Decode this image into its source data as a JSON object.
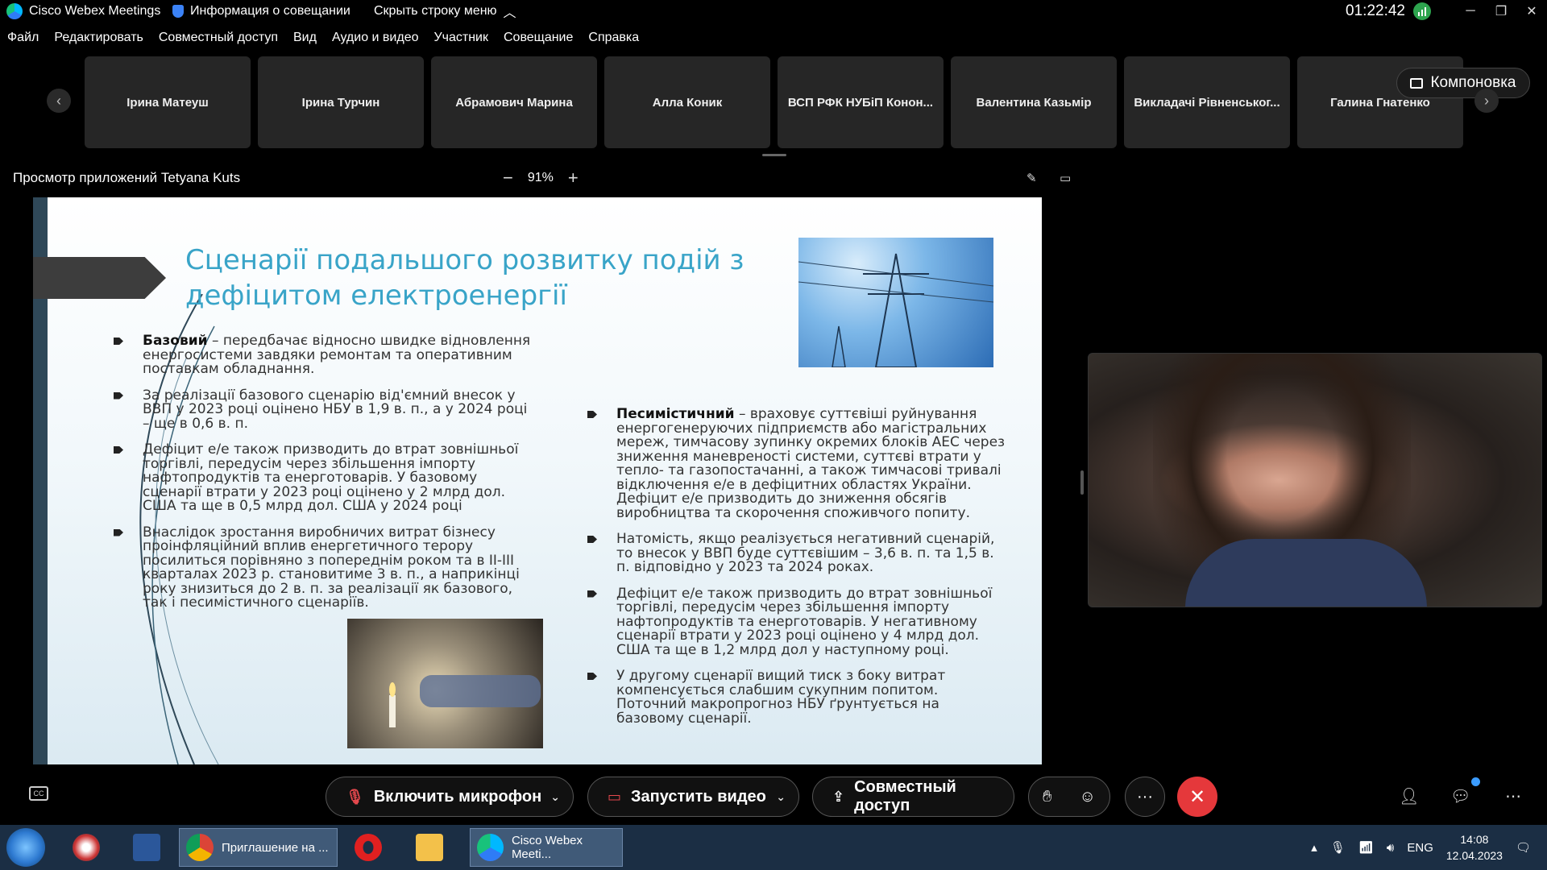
{
  "titlebar": {
    "app_name": "Cisco Webex Meetings",
    "meeting_info": "Информация о совещании",
    "hide_menu": "Скрыть строку меню",
    "time": "01:22:42"
  },
  "menu": [
    "Файл",
    "Редактировать",
    "Совместный доступ",
    "Вид",
    "Аудио и видео",
    "Участник",
    "Совещание",
    "Справка"
  ],
  "participants": [
    "Ірина Матеуш",
    "Ірина Турчин",
    "Абрамович Марина",
    "Алла Коник",
    "ВСП РФК НУБіП Конон...",
    "Валентина Казьмір",
    "Викладачі Рівненськог...",
    "Галина Гнатенко"
  ],
  "layout_button": "Компоновка",
  "share": {
    "title": "Просмотр приложений Tetyana Kuts",
    "zoom": "91%"
  },
  "slide": {
    "title": "Сценарії подальшого розвитку подій з дефіцитом електроенергії",
    "left_bullets": [
      {
        "bold": "Базовий",
        "text": " – передбачає відносно швидке відновлення енергосистеми завдяки ремонтам та оперативним поставкам обладнання."
      },
      {
        "bold": "",
        "text": "За реалізації базового сценарію від'ємний внесок у ВВП у 2023 році оцінено НБУ в 1,9 в. п., а у 2024 році – ще в 0,6 в. п."
      },
      {
        "bold": "",
        "text": "Дефіцит е/е також призводить до втрат зовнішньої торгівлі, передусім через збільшення імпорту нафтопродуктів та енерготоварів. У базовому сценарії втрати у 2023 році оцінено у 2 млрд дол. США та ще в 0,5 млрд дол. США у 2024 році"
      },
      {
        "bold": "",
        "text": "Внаслідок зростання виробничих витрат бізнесу проінфляційний вплив енергетичного терору посилиться порівняно з попереднім роком та в ІІ-ІІІ кварталах 2023 р. становитиме 3 в. п., а наприкінці року знизиться до 2 в. п. за реалізації як базового, так і песимістичного сценаріїв."
      }
    ],
    "right_bullets": [
      {
        "bold": "Песимістичний",
        "text": " – враховує суттєвіші руйнування енергогенеруючих підприємств або магістральних мереж, тимчасову зупинку окремих блоків АЕС через зниження маневреності системи, суттєві втрати у тепло- та газопостачанні, а також тимчасові тривалі відключення е/е в дефіцитних областях України. Дефіцит е/е призводить до зниження обсягів виробництва та скорочення споживчого попиту."
      },
      {
        "bold": "",
        "text": "Натомість, якщо реалізується негативний сценарій, то внесок у ВВП буде суттєвішим – 3,6 в. п. та 1,5 в. п. відповідно у 2023 та 2024 роках."
      },
      {
        "bold": "",
        "text": "Дефіцит е/е також призводить до втрат зовнішньої торгівлі, передусім через збільшення імпорту нафтопродуктів та енерготоварів. У негативному сценарії втрати у 2023 році оцінено у 4 млрд дол. США та ще в 1,2 млрд дол у наступному році."
      },
      {
        "bold": "",
        "text": "У другому сценарії вищий тиск з боку витрат компенсується слабшим сукупним попитом. Поточний макропрогноз НБУ ґрунтується на базовому сценарії."
      }
    ]
  },
  "controls": {
    "mic": "Включить микрофон",
    "video": "Запустить видео",
    "share": "Совместный доступ"
  },
  "taskbar": {
    "chrome_label": "Приглашение на ...",
    "webex_label": "Cisco Webex Meeti...",
    "lang": "ENG",
    "time": "14:08",
    "date": "12.04.2023"
  },
  "colors": {
    "slide_title": "#39a4c8",
    "end_call": "#e5383b",
    "muted_icon": "#e5484d",
    "taskbar": "#1b2e44"
  }
}
